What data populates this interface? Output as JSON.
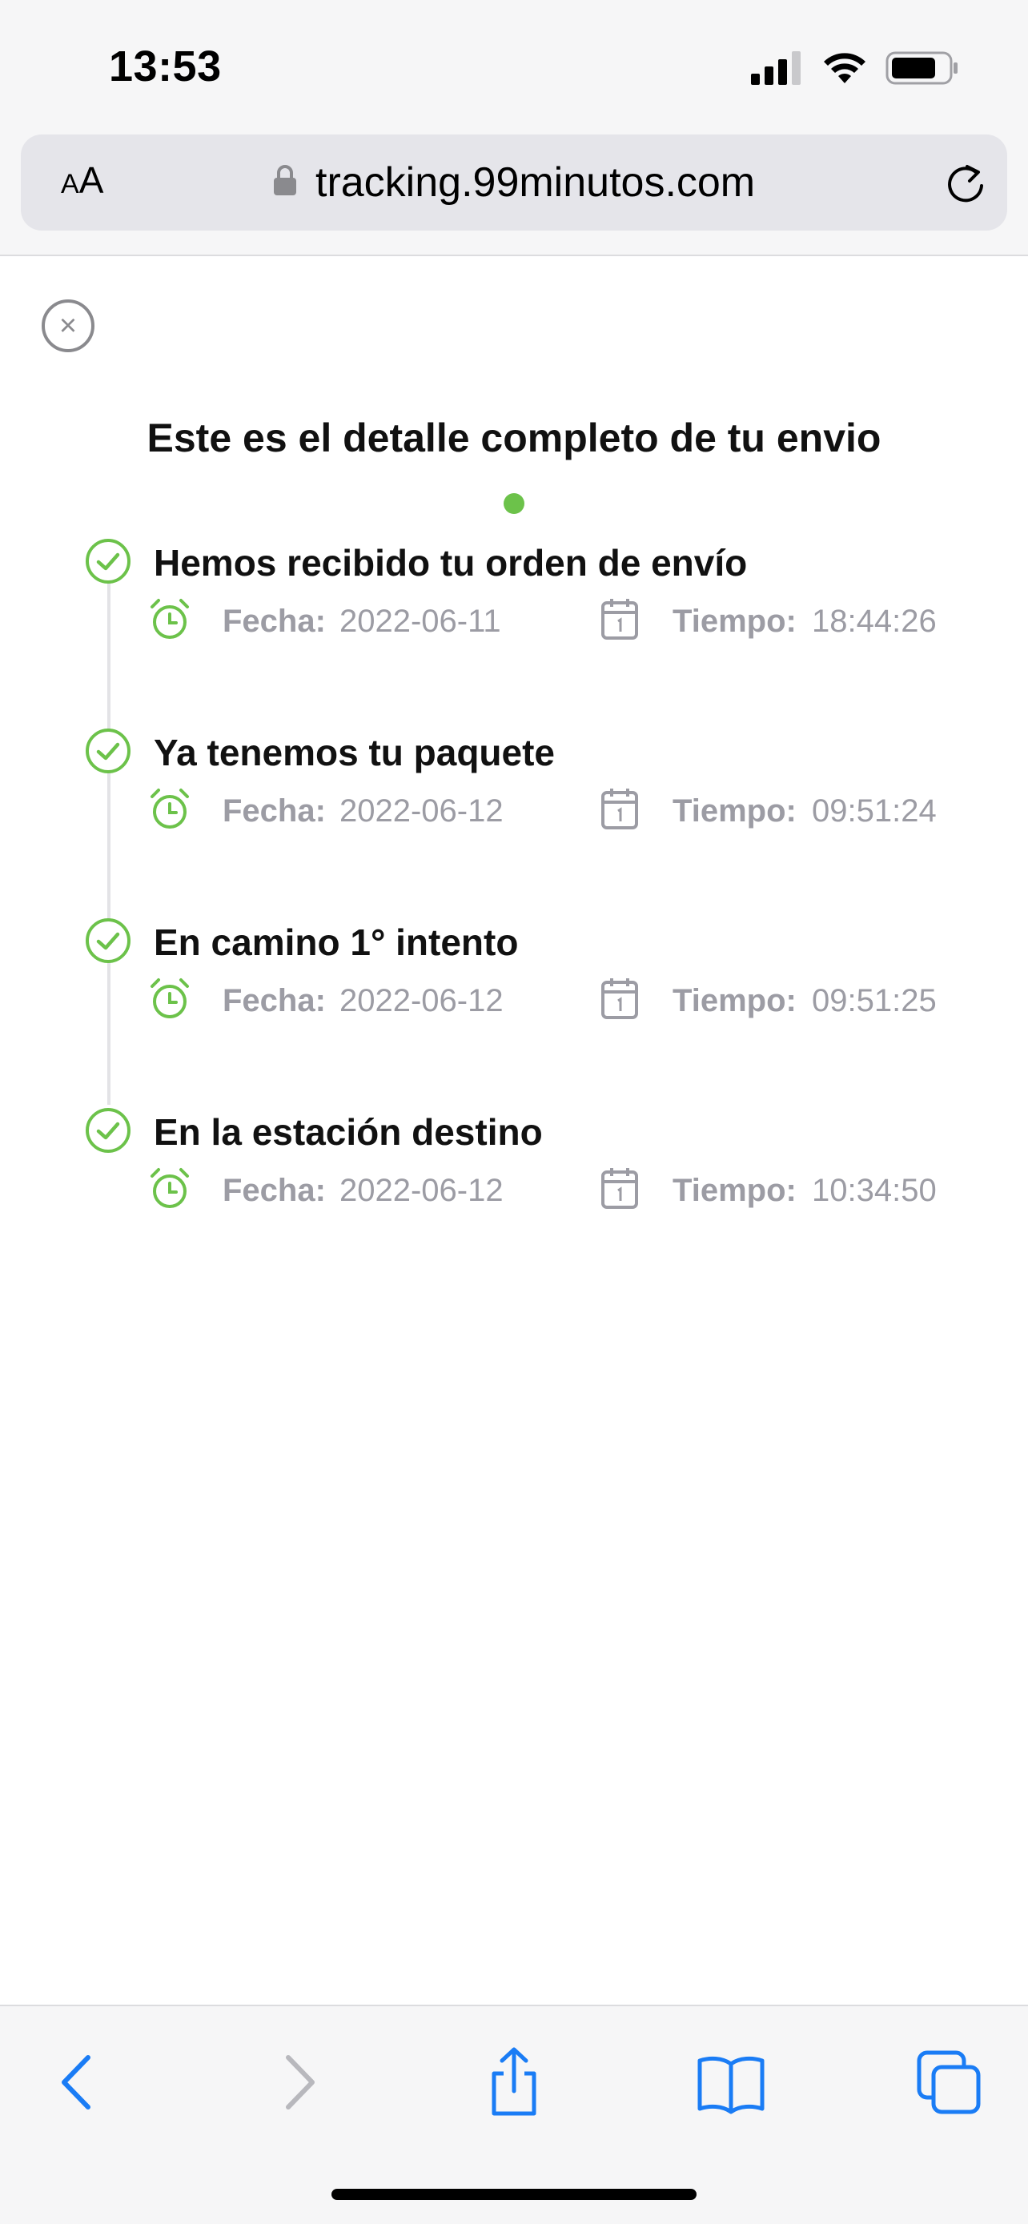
{
  "status_bar": {
    "time": "13:53"
  },
  "browser": {
    "aa_label_small": "A",
    "aa_label_big": "A",
    "url": "tracking.99minutos.com"
  },
  "page": {
    "close_symbol": "×",
    "title": "Este es el detalle completo de tu envio"
  },
  "labels": {
    "fecha": "Fecha:",
    "tiempo": "Tiempo:"
  },
  "events": [
    {
      "title": "Hemos recibido tu orden de envío",
      "fecha": "2022-06-11",
      "tiempo": "18:44:26"
    },
    {
      "title": "Ya tenemos tu paquete",
      "fecha": "2022-06-12",
      "tiempo": "09:51:24"
    },
    {
      "title": "En camino 1° intento",
      "fecha": "2022-06-12",
      "tiempo": "09:51:25"
    },
    {
      "title": "En la estación destino",
      "fecha": "2022-06-12",
      "tiempo": "10:34:50"
    }
  ],
  "colors": {
    "accent": "#6cc24a",
    "muted_text": "#9c9ca4",
    "ios_blue": "#1a7cf5"
  },
  "icons": [
    "signal-icon",
    "wifi-icon",
    "battery-icon",
    "lock-icon",
    "reload-icon",
    "close-icon",
    "check-circle-icon",
    "alarm-clock-icon",
    "calendar-icon",
    "back-icon",
    "forward-icon",
    "share-icon",
    "bookmarks-icon",
    "tabs-icon"
  ]
}
